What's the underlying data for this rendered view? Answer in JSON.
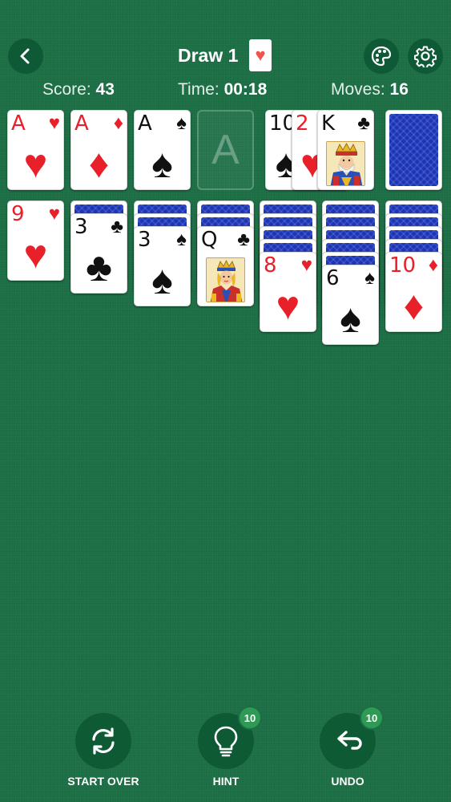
{
  "header": {
    "title": "Draw 1",
    "mode_suit": "♥"
  },
  "stats": {
    "score_label": "Score:",
    "score_value": "43",
    "time_label": "Time:",
    "time_value": "00:18",
    "moves_label": "Moves:",
    "moves_value": "16"
  },
  "foundations": [
    {
      "rank": "A",
      "suit": "♥",
      "color": "red"
    },
    {
      "rank": "A",
      "suit": "♦",
      "color": "red"
    },
    {
      "rank": "A",
      "suit": "♠",
      "color": "black"
    },
    {
      "placeholder": "A"
    }
  ],
  "waste": [
    {
      "rank": "10",
      "suit": "♠",
      "color": "black"
    },
    {
      "rank": "2",
      "suit": "♥",
      "color": "red"
    },
    {
      "rank": "K",
      "suit": "♣",
      "color": "black"
    }
  ],
  "tableau": [
    {
      "rank": "9",
      "suit": "♥",
      "color": "red"
    },
    {
      "rank": "3",
      "suit": "♣",
      "color": "black"
    },
    {
      "rank": "3",
      "suit": "♠",
      "color": "black"
    },
    {
      "rank": "Q",
      "suit": "♣",
      "color": "black"
    },
    {
      "rank": "8",
      "suit": "♥",
      "color": "red"
    },
    {
      "rank": "6",
      "suit": "♠",
      "color": "black"
    },
    {
      "rank": "10",
      "suit": "♦",
      "color": "red"
    }
  ],
  "footer": {
    "start_over_label": "START OVER",
    "hint_label": "HINT",
    "hint_count": "10",
    "undo_label": "UNDO",
    "undo_count": "10"
  },
  "colors": {
    "felt": "#1c6e45",
    "card_red": "#e8202a",
    "card_back": "#1a34b8",
    "badge": "#2e9a55"
  }
}
